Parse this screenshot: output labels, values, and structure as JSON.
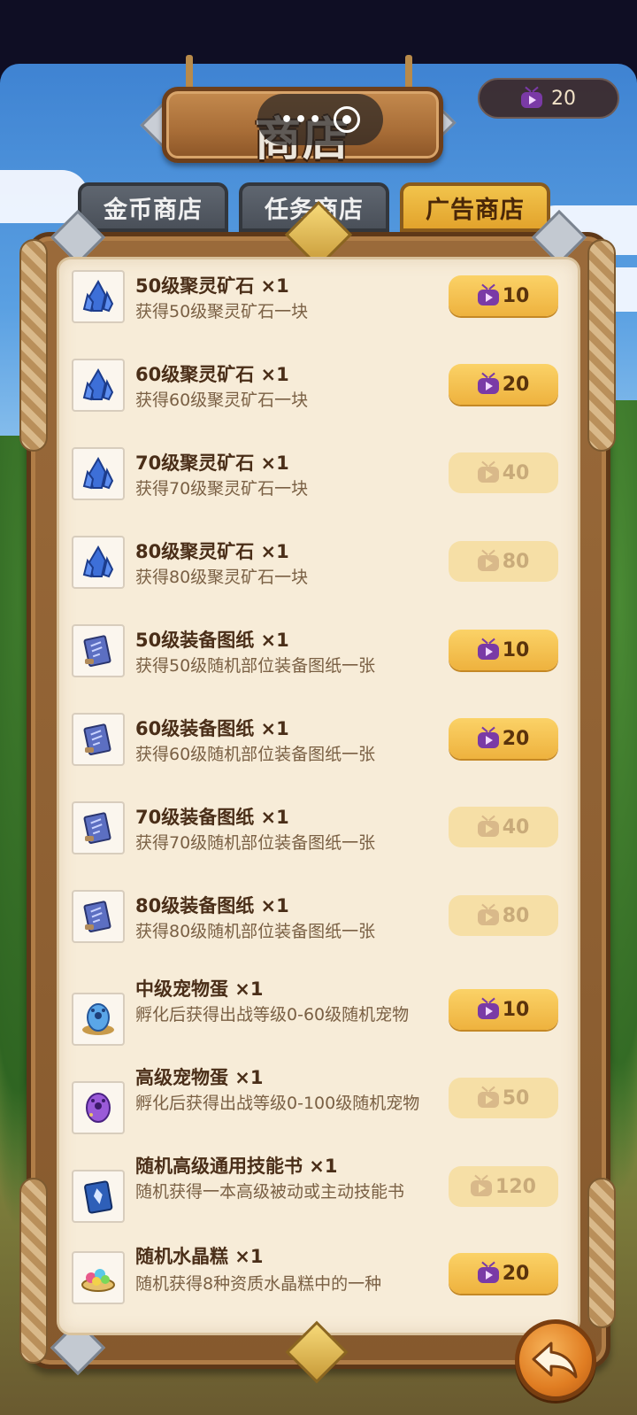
{
  "header": {
    "title": "商店",
    "capsule_dots": "•••",
    "tickets": "20"
  },
  "tabs": [
    {
      "label": "金币商店",
      "active": false
    },
    {
      "label": "任务商店",
      "active": false
    },
    {
      "label": "广告商店",
      "active": true
    }
  ],
  "items": [
    {
      "name": "50级聚灵矿石 ×1",
      "desc": "获得50级聚灵矿石一块",
      "price": "10",
      "enabled": true,
      "icon": "crystal-ore-icon"
    },
    {
      "name": "60级聚灵矿石 ×1",
      "desc": "获得60级聚灵矿石一块",
      "price": "20",
      "enabled": true,
      "icon": "crystal-ore-icon"
    },
    {
      "name": "70级聚灵矿石 ×1",
      "desc": "获得70级聚灵矿石一块",
      "price": "40",
      "enabled": false,
      "icon": "crystal-ore-icon"
    },
    {
      "name": "80级聚灵矿石 ×1",
      "desc": "获得80级聚灵矿石一块",
      "price": "80",
      "enabled": false,
      "icon": "crystal-ore-icon"
    },
    {
      "name": "50级装备图纸 ×1",
      "desc": "获得50级随机部位装备图纸一张",
      "price": "10",
      "enabled": true,
      "icon": "blueprint-scroll-icon"
    },
    {
      "name": "60级装备图纸 ×1",
      "desc": "获得60级随机部位装备图纸一张",
      "price": "20",
      "enabled": true,
      "icon": "blueprint-scroll-icon"
    },
    {
      "name": "70级装备图纸 ×1",
      "desc": "获得70级随机部位装备图纸一张",
      "price": "40",
      "enabled": false,
      "icon": "blueprint-scroll-icon"
    },
    {
      "name": "80级装备图纸 ×1",
      "desc": "获得80级随机部位装备图纸一张",
      "price": "80",
      "enabled": false,
      "icon": "blueprint-scroll-icon"
    },
    {
      "name": "中级宠物蛋 ×1",
      "desc": "孵化后获得出战等级0-60级随机宠物",
      "price": "10",
      "enabled": true,
      "icon": "blue-pet-egg-icon"
    },
    {
      "name": "高级宠物蛋 ×1",
      "desc": "孵化后获得出战等级0-100级随机宠物",
      "price": "50",
      "enabled": false,
      "icon": "purple-pet-egg-icon"
    },
    {
      "name": "随机高级通用技能书 ×1",
      "desc": "随机获得一本高级被动或主动技能书",
      "price": "120",
      "enabled": false,
      "icon": "skill-book-icon"
    },
    {
      "name": "随机水晶糕 ×1",
      "desc": "随机获得8种资质水晶糕中的一种",
      "price": "20",
      "enabled": true,
      "icon": "crystal-cake-icon"
    }
  ],
  "colors": {
    "accent": "#eeb23e",
    "tab_active": "#f2c44c",
    "ticket": "#7a3aa6"
  }
}
